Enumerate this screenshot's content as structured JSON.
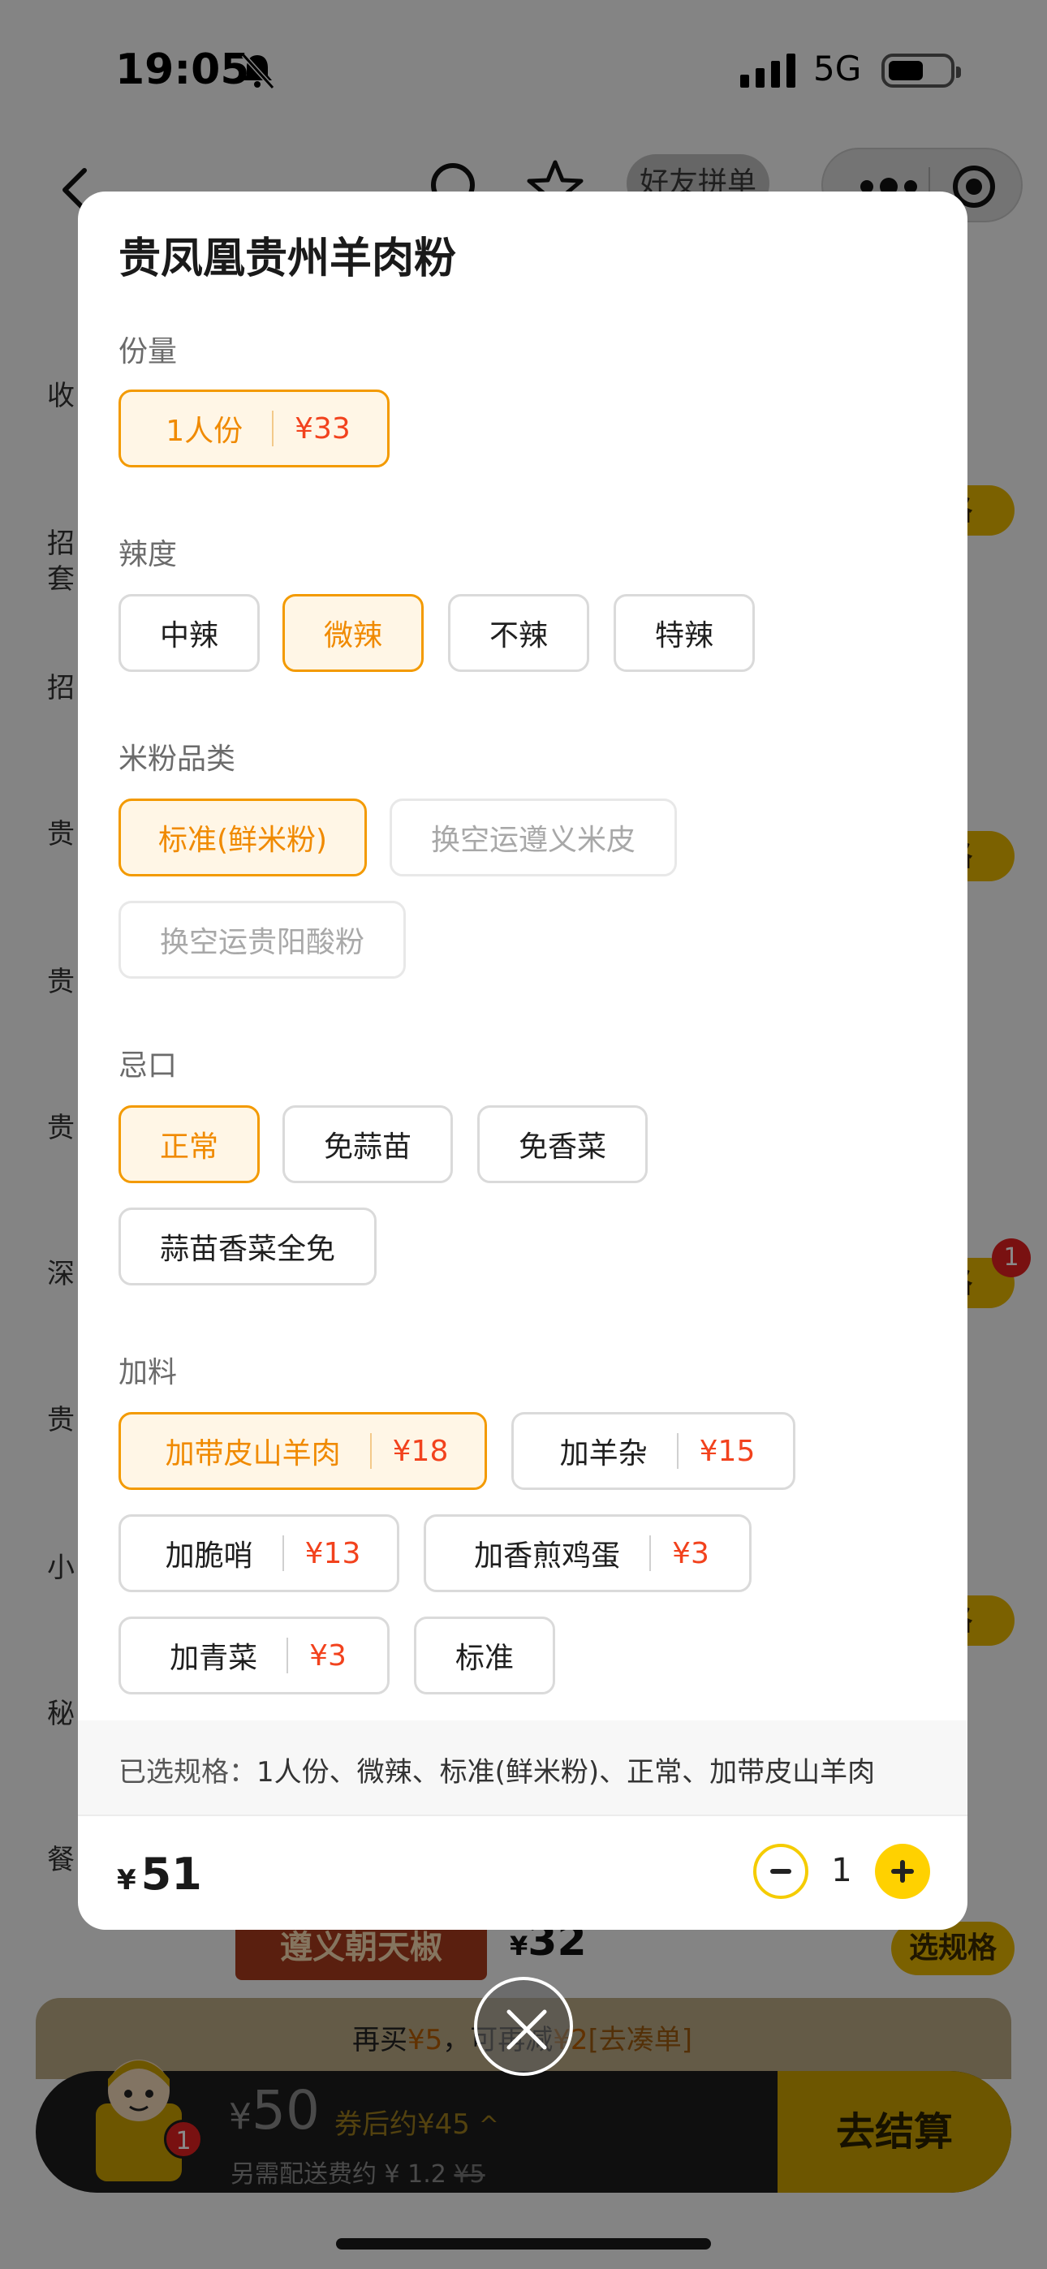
{
  "status_bar": {
    "time": "19:05",
    "network": "5G"
  },
  "nav": {
    "friends_order_label": "好友拼单"
  },
  "background": {
    "side_tabs": [
      "收",
      "招\n套",
      "招",
      "贵",
      "贵",
      "贵",
      "深",
      "贵",
      "小",
      "秘",
      "餐"
    ],
    "spec_chip_label": "格",
    "spec_chip_badge": "1",
    "product_image_text": "遵义朝天椒",
    "product_price_currency": "¥",
    "product_price": "32",
    "product_spec_button": "选规格"
  },
  "promo": {
    "prefix": "再买",
    "amount1": "¥5",
    "middle": "，可再减",
    "amount2": "¥2",
    "link": "[去凑单]"
  },
  "cart": {
    "badge": "1",
    "currency": "¥",
    "total": "50",
    "coupon_text": "券后约¥45",
    "fee_prefix": "另需配送费约 ¥ 1.2",
    "fee_original": "¥5",
    "checkout_label": "去结算"
  },
  "modal": {
    "title": "贵凤凰贵州羊肉粉",
    "sections": {
      "portion": {
        "label": "份量",
        "options": [
          {
            "name": "1人份",
            "price": "¥33",
            "selected": true
          }
        ]
      },
      "spice": {
        "label": "辣度",
        "options": [
          {
            "name": "中辣",
            "selected": false
          },
          {
            "name": "微辣",
            "selected": true
          },
          {
            "name": "不辣",
            "selected": false
          },
          {
            "name": "特辣",
            "selected": false
          }
        ]
      },
      "noodle": {
        "label": "米粉品类",
        "options": [
          {
            "name": "标准(鲜米粉)",
            "selected": true
          },
          {
            "name": "换空运遵义米皮",
            "disabled": true
          },
          {
            "name": "换空运贵阳酸粉",
            "disabled": true
          }
        ]
      },
      "avoid": {
        "label": "忌口",
        "options": [
          {
            "name": "正常",
            "selected": true
          },
          {
            "name": "免蒜苗",
            "selected": false
          },
          {
            "name": "免香菜",
            "selected": false
          },
          {
            "name": "蒜苗香菜全免",
            "selected": false
          }
        ]
      },
      "addons": {
        "label": "加料",
        "options": [
          {
            "name": "加带皮山羊肉",
            "price": "¥18",
            "selected": true
          },
          {
            "name": "加羊杂",
            "price": "¥15",
            "selected": false
          },
          {
            "name": "加脆哨",
            "price": "¥13",
            "selected": false
          },
          {
            "name": "加香煎鸡蛋",
            "price": "¥3",
            "selected": false
          },
          {
            "name": "加青菜",
            "price": "¥3",
            "selected": false
          },
          {
            "name": "标准",
            "selected": false
          }
        ]
      }
    },
    "summary_label": "已选规格：",
    "summary_value": "1人份、微辣、标准(鲜米粉)、正常、加带皮山羊肉",
    "total_currency": "¥",
    "total_value": "51",
    "quantity": "1"
  },
  "colors": {
    "accent": "#f39a00",
    "price_red": "#f2421d",
    "brand_yellow": "#ffd100"
  }
}
